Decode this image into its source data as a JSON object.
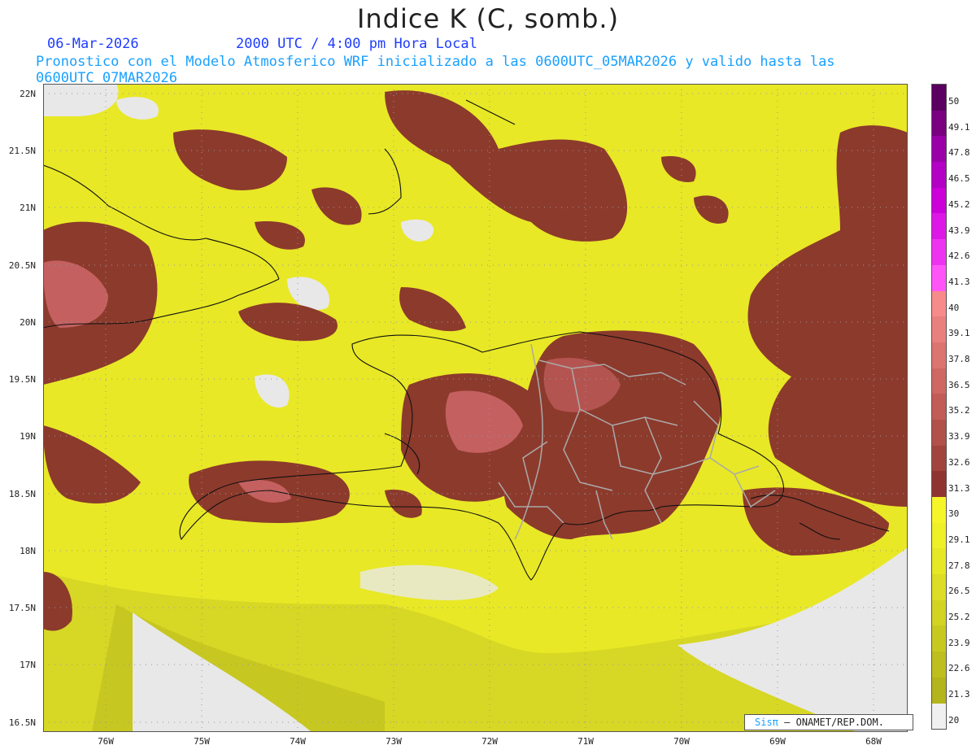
{
  "title": "Indice K (C, somb.)",
  "date": "06-Mar-2026",
  "time": "2000 UTC / 4:00 pm Hora Local",
  "subtitle": "Pronostico con el Modelo Atmosferico WRF inicializado a las 0600UTC_05MAR2026 y valido hasta las  0600UTC_07MAR2026",
  "lat_labels": [
    "22N",
    "21.5N",
    "21N",
    "20.5N",
    "20N",
    "19.5N",
    "19N",
    "18.5N",
    "18N",
    "17.5N",
    "17N",
    "16.5N"
  ],
  "lon_labels": [
    "76W",
    "75W",
    "74W",
    "73W",
    "72W",
    "71W",
    "70W",
    "69W",
    "68W"
  ],
  "colorbar": {
    "labels": [
      "50",
      "49.1",
      "47.8",
      "46.5",
      "45.2",
      "43.9",
      "42.6",
      "41.3",
      "40",
      "39.1",
      "37.8",
      "36.5",
      "35.2",
      "33.9",
      "32.6",
      "31.3",
      "30",
      "29.1",
      "27.8",
      "26.5",
      "25.2",
      "23.9",
      "22.6",
      "21.3",
      "20"
    ],
    "colors": [
      "#5a0060",
      "#7a0080",
      "#9a00a8",
      "#b400c4",
      "#cc00d8",
      "#dd18e6",
      "#ee33f0",
      "#ff55f8",
      "#f78a8a",
      "#e9807e",
      "#dc7470",
      "#cf6862",
      "#c15c56",
      "#b2504a",
      "#a2443e",
      "#903432",
      "#f6f52a",
      "#eef028",
      "#e6e826",
      "#dcdd24",
      "#d2d322",
      "#c8c920",
      "#bebe1e",
      "#b4b41c",
      "#f0f0f0"
    ]
  },
  "legend": {
    "white": "#e8e8e8",
    "yellow": "#e8e826",
    "brown": "#8c3a2c"
  },
  "credit": {
    "brand": "Sisπ",
    "text": "– ONAMET/REP.DOM."
  }
}
